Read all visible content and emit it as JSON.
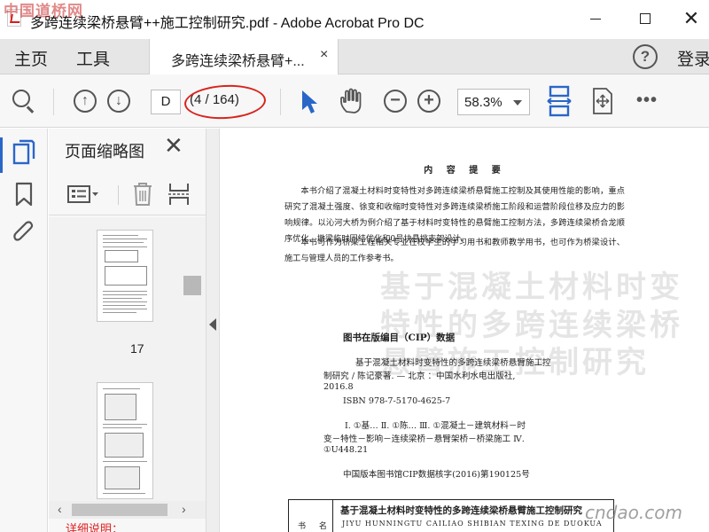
{
  "window": {
    "title": "多跨连续梁桥悬臂++施工控制研究.pdf - Adobe Acrobat Pro DC",
    "close_glyph": "✕"
  },
  "watermarks": {
    "top_left": "中国道桥网",
    "bottom_right": "cndao.com"
  },
  "menubar": {
    "home": "主页",
    "tools": "工具",
    "tab_label": "多跨连续梁桥悬臂+...",
    "tab_close": "×",
    "help": "?",
    "sign_in": "登录"
  },
  "toolbar": {
    "page_input": "D",
    "page_count": "4 / 164",
    "zoom": "58.3%",
    "more": "•••",
    "colors": {
      "accent": "#2a66c8",
      "highlight_oval": "#d8241d"
    }
  },
  "thumbnail_panel": {
    "title": "页面缩略图",
    "close": "✕",
    "thumbnails": [
      {
        "page_number": "17"
      },
      {
        "page_number": ""
      }
    ]
  },
  "document": {
    "heading": "内 容 提 要",
    "summary_paragraphs": [
      "本书介绍了混凝土材料时变特性对多跨连续梁桥悬臂施工控制及其使用性能的影响，重点研究了混凝土强度、徐变和收缩时变特性对多跨连续梁桥施工阶段和运营阶段位移及应力的影响规律。以沁河大桥为例介绍了基于材料时变特性的悬臂施工控制方法，多跨连续梁桥合龙顺序优化、墩梁临时固结优化和0号块悬挑支架设计。",
      "本书可作为桥梁工程相关专业在校学生的学习用书和教师教学用书，也可作为桥梁设计、施工与管理人员的工作参考书。"
    ],
    "cip_title": "图书在版编目（CIP）数据",
    "cip_lines": [
      "基于混凝土材料时变特性的多跨连续梁桥悬臂施工控",
      "制研究 / 陈记豪著. — 北京 ：中国水利水电出版社,",
      "2016.8",
      "ISBN 978-7-5170-4625-7",
      "Ⅰ. ①基… Ⅱ. ①陈… Ⅲ. ①混凝土－建筑材料－时",
      "变－特性－影响－连续梁桥－悬臂架桥－桥梁施工 Ⅳ.",
      "①U448.21",
      "中国版本图书馆CIP数据核字(2016)第190125号"
    ],
    "table": {
      "left_label": "书 名",
      "title": "基于混凝土材料时变特性的多跨连续梁桥悬臂施工控制研究",
      "pinyin": "JIYU HUNNINGTU CAILIAO SHIBIAN TEXING DE DUOKUA"
    },
    "ghost_text": "基于混凝土材料时变特性的多跨连续梁桥悬臂施工控制研究"
  },
  "bottom_note": "详细说明："
}
